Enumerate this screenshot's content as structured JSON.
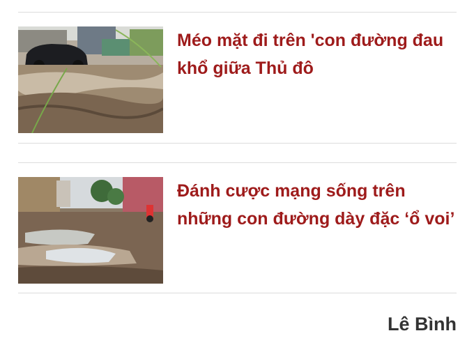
{
  "related_articles": [
    {
      "title": "Méo mặt đi trên 'con đường đau khổ giữa Thủ đô",
      "image_alt": "Muddy rutted road with a parked black car"
    },
    {
      "title": "Đánh cược mạng sống trên những con đường dày đặc ‘ổ voi’",
      "image_alt": "Road full of water-filled potholes"
    }
  ],
  "author": "Lê Bình",
  "colors": {
    "headline": "#9e1b1b",
    "author": "#333333",
    "divider": "#dcdcdc"
  }
}
